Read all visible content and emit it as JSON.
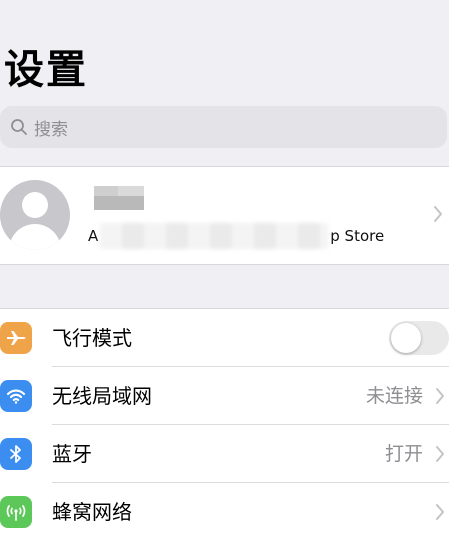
{
  "page": {
    "title": "设置"
  },
  "search": {
    "placeholder": "搜索",
    "icon": "search-icon"
  },
  "profile": {
    "subtitle_start": "A",
    "subtitle_end": "p Store",
    "avatar_icon": "person-silhouette-icon"
  },
  "settings": {
    "items": [
      {
        "label": "飞行模式",
        "icon": "airplane-icon",
        "icon_color": "#f0a44a",
        "toggle_on": false
      },
      {
        "label": "无线局域网",
        "icon": "wifi-icon",
        "icon_color": "#3b8ef0",
        "value": "未连接"
      },
      {
        "label": "蓝牙",
        "icon": "bluetooth-icon",
        "icon_color": "#3b8ef0",
        "value": "打开"
      },
      {
        "label": "蜂窝网络",
        "icon": "cellular-antenna-icon",
        "icon_color": "#5cc85a"
      }
    ]
  },
  "colors": {
    "background": "#efeff4",
    "search_background": "#e3e3e8",
    "secondary_text": "#8e8e93",
    "toggle_off": "#e9e9ea"
  }
}
